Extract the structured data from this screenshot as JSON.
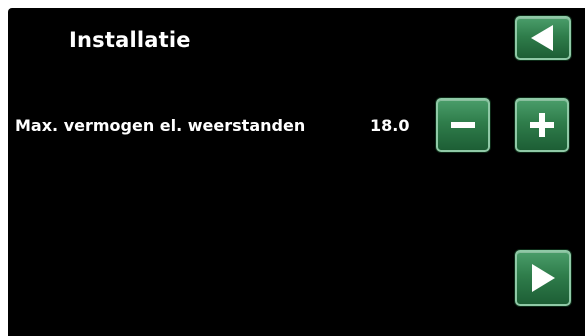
{
  "header": {
    "title": "Installatie"
  },
  "setting": {
    "label": "Max. vermogen el. weerstanden",
    "value": "18.0"
  },
  "buttons": {
    "back_icon": "triangle-left-icon",
    "minus_icon": "minus-icon",
    "plus_icon": "plus-icon",
    "next_icon": "triangle-right-icon"
  },
  "colors": {
    "background": "#000000",
    "button_green": "#2f7d4b",
    "button_border": "#8fc9a6",
    "text": "#ffffff"
  }
}
